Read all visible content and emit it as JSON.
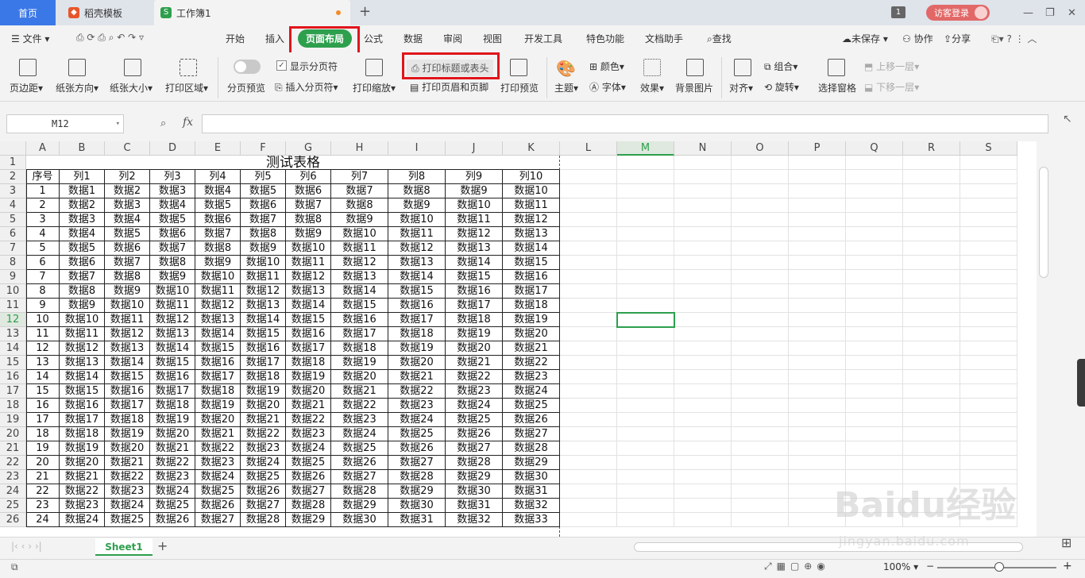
{
  "tabs": {
    "home": "首页",
    "template": "稻壳模板",
    "workbook": "工作簿1",
    "new_tab": "+"
  },
  "window": {
    "badge": "1",
    "login": "访客登录",
    "minimize": "—",
    "restore": "❐",
    "close": "✕"
  },
  "menu": {
    "file": "文件",
    "items": [
      "开始",
      "插入",
      "页面布局",
      "公式",
      "数据",
      "审阅",
      "视图",
      "开发工具",
      "特色功能",
      "文档助手"
    ],
    "search": "查找",
    "unsaved": "未保存",
    "collab": "协作",
    "share": "分享"
  },
  "ribbon": {
    "margins": "页边距",
    "orientation": "纸张方向",
    "size": "纸张大小",
    "print_area": "打印区域",
    "page_preview": "分页预览",
    "show_breaks": "显示分页符",
    "insert_break": "插入分页符",
    "print_scale": "打印缩放",
    "print_titles": "打印标题或表头",
    "print_header_footer": "打印页眉和页脚",
    "print_preview": "打印预览",
    "theme": "主题",
    "color": "颜色",
    "font": "字体",
    "effects": "效果",
    "background": "背景图片",
    "align": "对齐",
    "group": "组合",
    "rotate": "旋转",
    "select_pane": "选择窗格",
    "bring_forward": "上移一层",
    "send_backward": "下移一层"
  },
  "formula_bar": {
    "name_box": "M12",
    "fx": "fx",
    "value": ""
  },
  "columns": [
    "A",
    "B",
    "C",
    "D",
    "E",
    "F",
    "G",
    "H",
    "I",
    "J",
    "K",
    "L",
    "M",
    "N",
    "O",
    "P",
    "Q",
    "R",
    "S"
  ],
  "rows": [
    "1",
    "2",
    "3",
    "4",
    "5",
    "6",
    "7",
    "8",
    "9",
    "10",
    "11",
    "12",
    "13",
    "14",
    "15",
    "16",
    "17",
    "18",
    "19",
    "20",
    "21",
    "22",
    "23",
    "24",
    "25",
    "26"
  ],
  "table": {
    "title": "测试表格",
    "headers": [
      "序号",
      "列1",
      "列2",
      "列3",
      "列4",
      "列5",
      "列6",
      "列7",
      "列8",
      "列9",
      "列10"
    ],
    "rows": [
      [
        "1",
        "数据1",
        "数据2",
        "数据3",
        "数据4",
        "数据5",
        "数据6",
        "数据7",
        "数据8",
        "数据9",
        "数据10"
      ],
      [
        "2",
        "数据2",
        "数据3",
        "数据4",
        "数据5",
        "数据6",
        "数据7",
        "数据8",
        "数据9",
        "数据10",
        "数据11"
      ],
      [
        "3",
        "数据3",
        "数据4",
        "数据5",
        "数据6",
        "数据7",
        "数据8",
        "数据9",
        "数据10",
        "数据11",
        "数据12"
      ],
      [
        "4",
        "数据4",
        "数据5",
        "数据6",
        "数据7",
        "数据8",
        "数据9",
        "数据10",
        "数据11",
        "数据12",
        "数据13"
      ],
      [
        "5",
        "数据5",
        "数据6",
        "数据7",
        "数据8",
        "数据9",
        "数据10",
        "数据11",
        "数据12",
        "数据13",
        "数据14"
      ],
      [
        "6",
        "数据6",
        "数据7",
        "数据8",
        "数据9",
        "数据10",
        "数据11",
        "数据12",
        "数据13",
        "数据14",
        "数据15"
      ],
      [
        "7",
        "数据7",
        "数据8",
        "数据9",
        "数据10",
        "数据11",
        "数据12",
        "数据13",
        "数据14",
        "数据15",
        "数据16"
      ],
      [
        "8",
        "数据8",
        "数据9",
        "数据10",
        "数据11",
        "数据12",
        "数据13",
        "数据14",
        "数据15",
        "数据16",
        "数据17"
      ],
      [
        "9",
        "数据9",
        "数据10",
        "数据11",
        "数据12",
        "数据13",
        "数据14",
        "数据15",
        "数据16",
        "数据17",
        "数据18"
      ],
      [
        "10",
        "数据10",
        "数据11",
        "数据12",
        "数据13",
        "数据14",
        "数据15",
        "数据16",
        "数据17",
        "数据18",
        "数据19"
      ],
      [
        "11",
        "数据11",
        "数据12",
        "数据13",
        "数据14",
        "数据15",
        "数据16",
        "数据17",
        "数据18",
        "数据19",
        "数据20"
      ],
      [
        "12",
        "数据12",
        "数据13",
        "数据14",
        "数据15",
        "数据16",
        "数据17",
        "数据18",
        "数据19",
        "数据20",
        "数据21"
      ],
      [
        "13",
        "数据13",
        "数据14",
        "数据15",
        "数据16",
        "数据17",
        "数据18",
        "数据19",
        "数据20",
        "数据21",
        "数据22"
      ],
      [
        "14",
        "数据14",
        "数据15",
        "数据16",
        "数据17",
        "数据18",
        "数据19",
        "数据20",
        "数据21",
        "数据22",
        "数据23"
      ],
      [
        "15",
        "数据15",
        "数据16",
        "数据17",
        "数据18",
        "数据19",
        "数据20",
        "数据21",
        "数据22",
        "数据23",
        "数据24"
      ],
      [
        "16",
        "数据16",
        "数据17",
        "数据18",
        "数据19",
        "数据20",
        "数据21",
        "数据22",
        "数据23",
        "数据24",
        "数据25"
      ],
      [
        "17",
        "数据17",
        "数据18",
        "数据19",
        "数据20",
        "数据21",
        "数据22",
        "数据23",
        "数据24",
        "数据25",
        "数据26"
      ],
      [
        "18",
        "数据18",
        "数据19",
        "数据20",
        "数据21",
        "数据22",
        "数据23",
        "数据24",
        "数据25",
        "数据26",
        "数据27"
      ],
      [
        "19",
        "数据19",
        "数据20",
        "数据21",
        "数据22",
        "数据23",
        "数据24",
        "数据25",
        "数据26",
        "数据27",
        "数据28"
      ],
      [
        "20",
        "数据20",
        "数据21",
        "数据22",
        "数据23",
        "数据24",
        "数据25",
        "数据26",
        "数据27",
        "数据28",
        "数据29"
      ],
      [
        "21",
        "数据21",
        "数据22",
        "数据23",
        "数据24",
        "数据25",
        "数据26",
        "数据27",
        "数据28",
        "数据29",
        "数据30"
      ],
      [
        "22",
        "数据22",
        "数据23",
        "数据24",
        "数据25",
        "数据26",
        "数据27",
        "数据28",
        "数据29",
        "数据30",
        "数据31"
      ],
      [
        "23",
        "数据23",
        "数据24",
        "数据25",
        "数据26",
        "数据27",
        "数据28",
        "数据29",
        "数据30",
        "数据31",
        "数据32"
      ],
      [
        "24",
        "数据24",
        "数据25",
        "数据26",
        "数据27",
        "数据28",
        "数据29",
        "数据30",
        "数据31",
        "数据32",
        "数据33"
      ]
    ]
  },
  "sheet": {
    "name": "Sheet1",
    "add": "+"
  },
  "status": {
    "zoom": "100%",
    "zoom_out": "−",
    "zoom_in": "+"
  },
  "watermark": {
    "main": "Baidu经验",
    "sub": "jingyan.baidu.com"
  },
  "colors": {
    "accent": "#2e9f4d",
    "highlight": "#e0151b",
    "home_tab": "#3b78e7"
  }
}
